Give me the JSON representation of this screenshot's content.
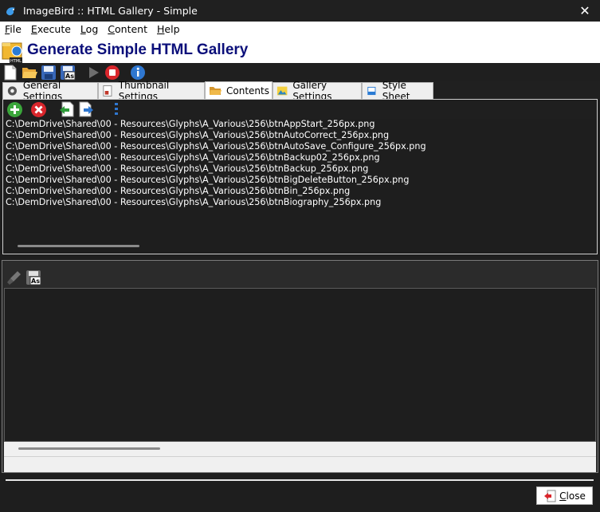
{
  "window": {
    "title": "ImageBird :: HTML Gallery - Simple",
    "close_glyph": "✕"
  },
  "menu": [
    {
      "underline": "F",
      "rest": "ile"
    },
    {
      "underline": "E",
      "rest": "xecute"
    },
    {
      "underline": "L",
      "rest": "og"
    },
    {
      "underline": "C",
      "rest": "ontent"
    },
    {
      "underline": "H",
      "rest": "elp"
    }
  ],
  "header": {
    "title": "Generate Simple HTML Gallery",
    "logo_badge": "HTML"
  },
  "toolbar": {
    "icons": [
      "new-document-icon",
      "open-folder-icon",
      "save-icon",
      "save-as-icon",
      "run-icon",
      "stop-icon",
      "info-icon"
    ],
    "save_as_badge": "As"
  },
  "tabs": [
    {
      "label": "General Settings",
      "icon": "gear-icon",
      "active": false
    },
    {
      "label": "Thumbnail Settings",
      "icon": "thumbnail-icon",
      "active": false
    },
    {
      "label": "Contents",
      "icon": "folder-icon",
      "active": true
    },
    {
      "label": "Gallery Settings",
      "icon": "gallery-icon",
      "active": false
    },
    {
      "label": "Style Sheet",
      "icon": "stylesheet-icon",
      "active": false
    }
  ],
  "contents": {
    "toolbar_icons": [
      "add-icon",
      "remove-icon",
      "import-icon",
      "export-icon",
      "sort-icon"
    ],
    "files": [
      "C:\\DemDrive\\Shared\\00 - Resources\\Glyphs\\A_Various\\256\\btnAppStart_256px.png",
      "C:\\DemDrive\\Shared\\00 - Resources\\Glyphs\\A_Various\\256\\btnAutoCorrect_256px.png",
      "C:\\DemDrive\\Shared\\00 - Resources\\Glyphs\\A_Various\\256\\btnAutoSave_Configure_256px.png",
      "C:\\DemDrive\\Shared\\00 - Resources\\Glyphs\\A_Various\\256\\btnBackup02_256px.png",
      "C:\\DemDrive\\Shared\\00 - Resources\\Glyphs\\A_Various\\256\\btnBackup_256px.png",
      "C:\\DemDrive\\Shared\\00 - Resources\\Glyphs\\A_Various\\256\\btnBigDeleteButton_256px.png",
      "C:\\DemDrive\\Shared\\00 - Resources\\Glyphs\\A_Various\\256\\btnBin_256px.png",
      "C:\\DemDrive\\Shared\\00 - Resources\\Glyphs\\A_Various\\256\\btnBiography_256px.png"
    ]
  },
  "lower": {
    "toolbar_icons": [
      "clear-icon",
      "save-as-icon"
    ],
    "save_as_badge": "As"
  },
  "footer": {
    "close_underline": "C",
    "close_rest": "lose"
  },
  "colors": {
    "heading": "#0b0f7a",
    "add": "#3aa63a",
    "remove": "#d9262c",
    "info": "#2f77d0"
  }
}
